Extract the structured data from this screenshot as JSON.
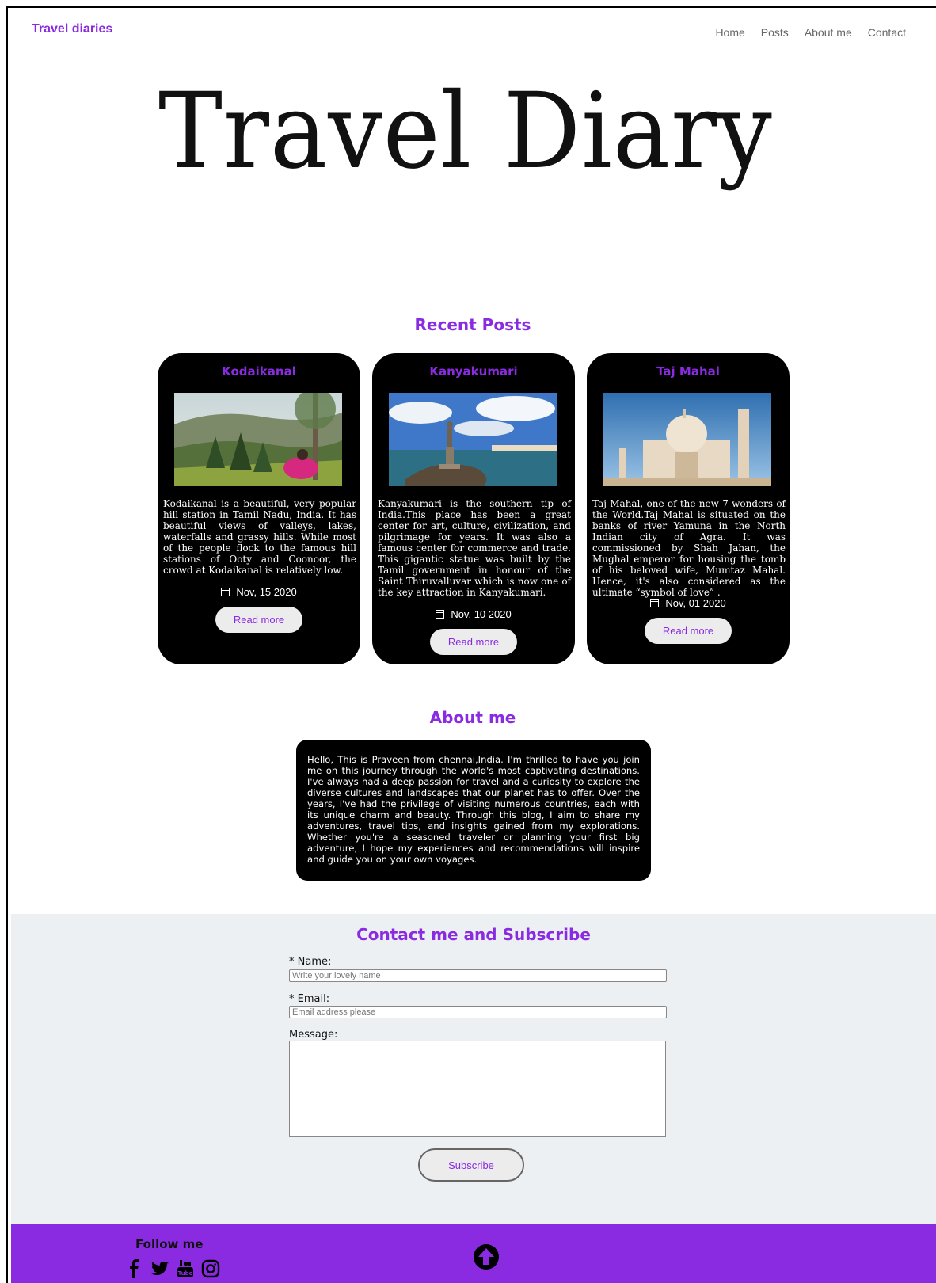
{
  "nav": {
    "brand": "Travel diaries",
    "links": [
      "Home",
      "Posts",
      "About me",
      "Contact"
    ]
  },
  "hero": {
    "title": "Travel Diary"
  },
  "recent": {
    "heading": "Recent Posts",
    "posts": [
      {
        "title": "Kodaikanal",
        "text": "Kodaikanal is a beautiful, very popular hill station in Tamil Nadu, India. It has beautiful views of valleys, lakes, waterfalls and grassy hills. While most of the people flock to the famous hill stations of Ooty and Coonoor, the crowd at Kodaikanal is relatively low.",
        "date": "Nov, 15 2020",
        "button": "Read more"
      },
      {
        "title": "Kanyakumari",
        "text": "Kanyakumari is the southern tip of India.This place has been a great center for art, culture, civilization, and pilgrimage for years. It was also a famous center for commerce and trade. This gigantic statue was built by the Tamil government in honour of the Saint Thiruvalluvar which is now one of the key attraction in Kanyakumari.",
        "date": "Nov, 10 2020",
        "button": "Read more"
      },
      {
        "title": "Taj Mahal",
        "text": "Taj Mahal, one of the new 7 wonders of the World.Taj Mahal is situated on the banks of river Yamuna in the North Indian city of Agra. It was commissioned by Shah Jahan, the Mughal emperor for housing the tomb of his beloved wife, Mumtaz Mahal. Hence, it's also considered as the ultimate “symbol of love” .",
        "date": "Nov, 01 2020",
        "button": "Read more"
      }
    ]
  },
  "about": {
    "heading": "About me",
    "text": "Hello, This is Praveen from chennai,India. I'm thrilled to have you join me on this journey through the world's most captivating destinations. I've always had a deep passion for travel and a curiosity to explore the diverse cultures and landscapes that our planet has to offer. Over the years, I've had the privilege of visiting numerous countries, each with its unique charm and beauty. Through this blog, I aim to share my adventures, travel tips, and insights gained from my explorations. Whether you're a seasoned traveler or planning your first big adventure, I hope my experiences and recommendations will inspire and guide you on your own voyages."
  },
  "contact": {
    "heading": "Contact me and Subscribe",
    "name_label": "* Name:",
    "name_placeholder": "Write your lovely name",
    "email_label": "* Email:",
    "email_placeholder": "Email address please",
    "message_label": "Message:",
    "button": "Subscribe"
  },
  "footer": {
    "follow": "Follow me",
    "icons": [
      "facebook-icon",
      "twitter-icon",
      "youtube-icon",
      "instagram-icon"
    ]
  },
  "colors": {
    "accent": "#8a2be2",
    "card": "#000000",
    "contact_bg": "#ecf0f3"
  }
}
